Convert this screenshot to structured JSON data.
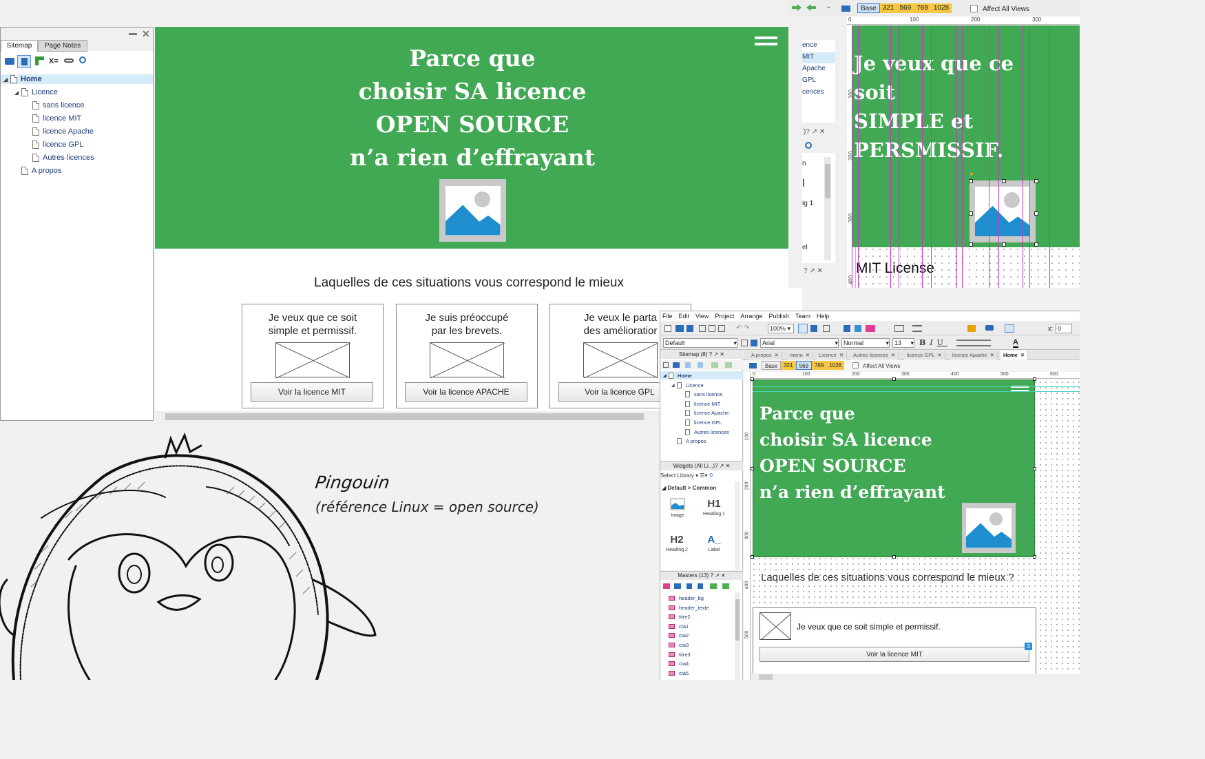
{
  "left_panel": {
    "tabs": [
      "Sitemap",
      "Page Notes"
    ],
    "tree": [
      {
        "label": "Home",
        "level": 0
      },
      {
        "label": "Licence",
        "level": 1
      },
      {
        "label": "sans licence",
        "level": 2
      },
      {
        "label": "licence MIT",
        "level": 2
      },
      {
        "label": "licence Apache",
        "level": 2
      },
      {
        "label": "licence GPL",
        "level": 2
      },
      {
        "label": "Autres licences",
        "level": 2
      },
      {
        "label": "A propos",
        "level": 1
      }
    ]
  },
  "main_page": {
    "hero_lines": [
      "Parce que",
      "choisir SA licence",
      "OPEN SOURCE",
      "n’a rien d’effrayant"
    ],
    "question": "Laquelles de ces situations vous correspond le mieux",
    "cards": [
      {
        "title": [
          "Je veux que ce soit",
          "simple et permissif."
        ],
        "button": "Voir la licence MIT"
      },
      {
        "title": [
          "Je suis préoccupé",
          "par les brevets."
        ],
        "button": "Voir la licence APACHE"
      },
      {
        "title": [
          "Je veux le parta",
          "des amélioratior"
        ],
        "button": "Voir la licence GPL"
      }
    ]
  },
  "top_right": {
    "breakpoints": [
      "Base",
      "321",
      "569",
      "769",
      "1028"
    ],
    "affect_all_views": "Affect All Views",
    "ruler": [
      "0",
      "100",
      "200",
      "300"
    ],
    "vruler": [
      "100",
      "200",
      "300",
      "400"
    ],
    "partial_list": [
      "ence",
      "MIT",
      "Apache",
      "GPL",
      "cences"
    ],
    "partial_panel": [
      ")?",
      "n",
      "l",
      "ig 1",
      "el"
    ],
    "hero_lines": [
      "Je veux que ce",
      "soit",
      "SIMPLE et",
      "PERSMISSIF."
    ],
    "mit_label": "MIT License"
  },
  "sketch": {
    "title": "Pingouin",
    "subtitle": "(référence Linux = open source)"
  },
  "axure": {
    "menu": [
      "File",
      "Edit",
      "View",
      "Project",
      "Arrange",
      "Publish",
      "Team",
      "Help"
    ],
    "zoom": "100%",
    "style_default": "Default",
    "font": "Arial",
    "weight": "Normal",
    "size": "13",
    "x_label": "x:",
    "x_value": "0",
    "sitemap_header": "Sitemap (8)",
    "sitemap": [
      {
        "label": "Home",
        "level": 0
      },
      {
        "label": "Licence",
        "level": 1
      },
      {
        "label": "sans licence",
        "level": 2
      },
      {
        "label": "licence MIT",
        "level": 2
      },
      {
        "label": "licence Apache",
        "level": 2
      },
      {
        "label": "licence GPL",
        "level": 2
      },
      {
        "label": "Autres licences",
        "level": 2
      },
      {
        "label": "A propos",
        "level": 1
      }
    ],
    "widgets_header": "Widgets (All Li...)?",
    "select_library": "Select Library",
    "library_group": "Default > Common",
    "widgets": [
      {
        "glyph": "",
        "label": "Image"
      },
      {
        "glyph": "H1",
        "label": "Heading 1"
      },
      {
        "glyph": "H2",
        "label": "Heading 2"
      },
      {
        "glyph": "A_",
        "label": "Label"
      }
    ],
    "masters_header": "Masters (13)",
    "masters": [
      "header_bg",
      "header_texte",
      "titre2",
      "cta1",
      "cta2",
      "cta3",
      "titre3",
      "cta4",
      "cta5"
    ],
    "tabs": [
      "A propos",
      "menu",
      "Licence",
      "Autres licences",
      "licence GPL",
      "licence Apache",
      "Home"
    ],
    "breakpoints": [
      "Base",
      "321",
      "569",
      "769",
      "1028"
    ],
    "affect_all_views": "Affect All Views",
    "ruler": [
      "0",
      "100",
      "200",
      "300",
      "400",
      "500",
      "600"
    ],
    "vruler": [
      "100",
      "200",
      "300",
      "400",
      "500"
    ],
    "hero_lines": [
      "Parce que",
      "choisir SA licence",
      "OPEN SOURCE",
      "n’a rien d’effrayant"
    ],
    "question": "Laquelles de ces situations vous correspond le mieux ?",
    "card_text": "Je veux que ce soit simple et permissif.",
    "card_button": "Voir la licence MIT",
    "badge": "3"
  },
  "colors": {
    "green": "#41a853",
    "guide": "#cc33cc",
    "breakpoint": "#f6c644"
  }
}
